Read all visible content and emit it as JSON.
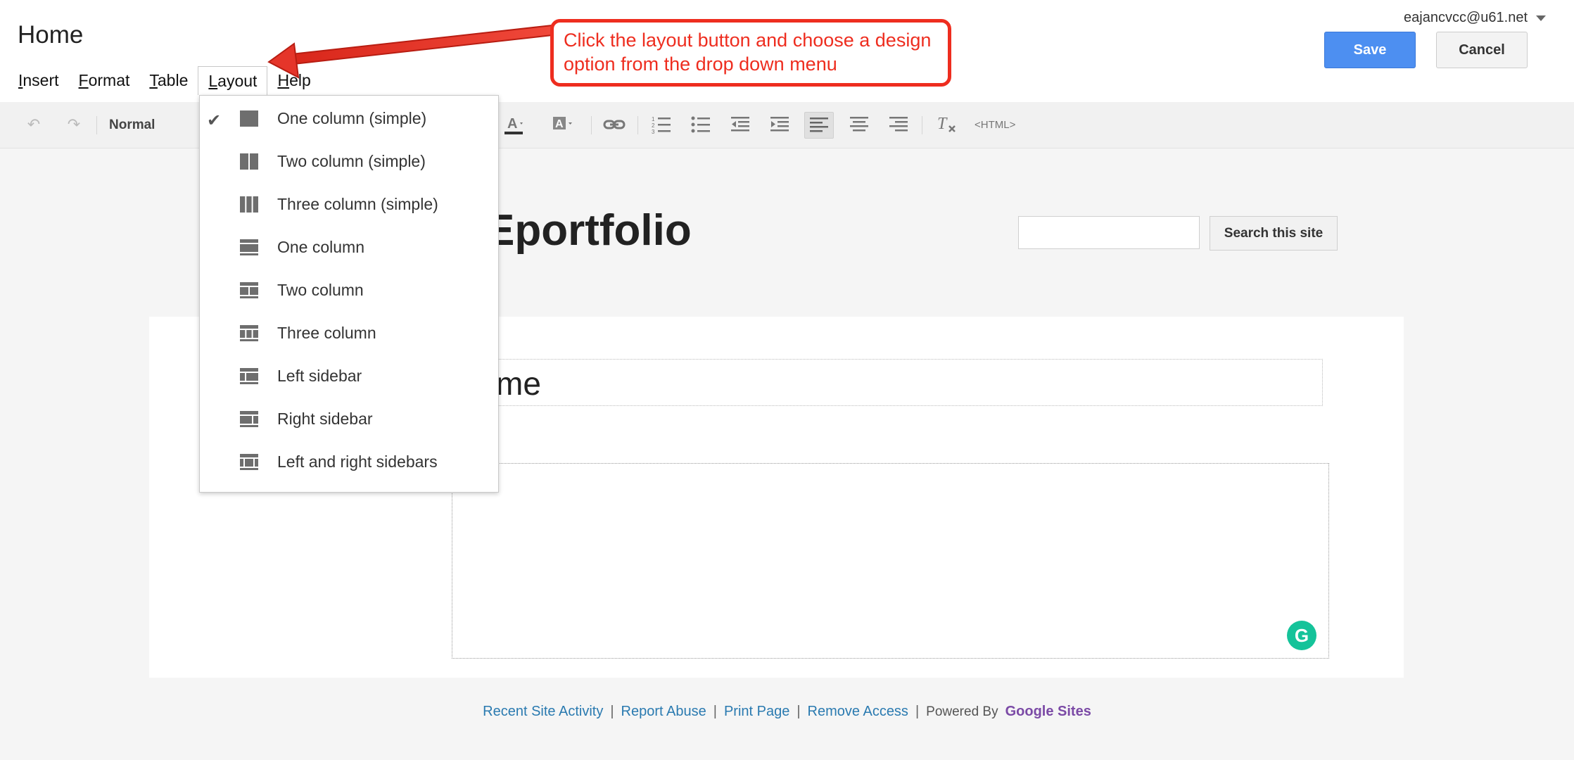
{
  "header": {
    "title": "Home",
    "account": "eajancvcc@u61.net"
  },
  "actions": {
    "save": "Save",
    "cancel": "Cancel"
  },
  "menubar": {
    "insert": {
      "u": "I",
      "rest": "nsert"
    },
    "format": {
      "u": "F",
      "rest": "ormat"
    },
    "table": {
      "u": "T",
      "rest": "able"
    },
    "layout": {
      "u": "L",
      "rest": "ayout"
    },
    "help": {
      "u": "H",
      "rest": "elp"
    }
  },
  "toolbar": {
    "style": "Normal",
    "html": "<HTML>"
  },
  "layout_menu": {
    "items": [
      {
        "label": "One column (simple)",
        "checked": true
      },
      {
        "label": "Two column (simple)"
      },
      {
        "label": "Three column (simple)"
      },
      {
        "label": "One column"
      },
      {
        "label": "Two column"
      },
      {
        "label": "Three column"
      },
      {
        "label": "Left sidebar"
      },
      {
        "label": "Right sidebar"
      },
      {
        "label": "Left and right sidebars"
      }
    ]
  },
  "site": {
    "title": "Eportfolio",
    "search_button": "Search this site",
    "page_heading": "me"
  },
  "callout": {
    "text": "Click the layout button and choose a design option from the drop down menu"
  },
  "footer": {
    "recent": "Recent Site Activity",
    "report": "Report Abuse",
    "print": "Print Page",
    "remove": "Remove Access",
    "powered": "Powered By",
    "brand": "Google Sites",
    "sep": "|"
  },
  "colors": {
    "accent": "#4d8ff1",
    "annotation": "#ee2d1f",
    "link": "#2a7ab0",
    "brand": "#7b4aa6"
  }
}
